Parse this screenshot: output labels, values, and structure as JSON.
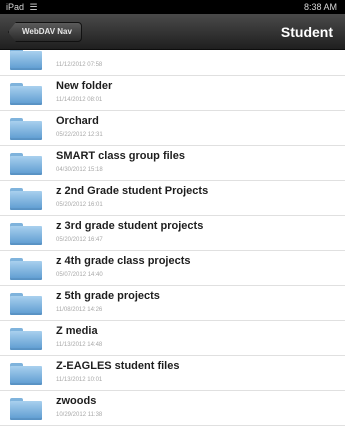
{
  "status_bar": {
    "carrier": "iPad",
    "time": "8:38 AM"
  },
  "nav": {
    "back_label": "WebDAV Nav",
    "title": "Student"
  },
  "folders": [
    {
      "name": "",
      "date": "11/12/2012 07:58"
    },
    {
      "name": "New folder",
      "date": "11/14/2012 08:01"
    },
    {
      "name": "Orchard",
      "date": "05/22/2012 12:31"
    },
    {
      "name": "SMART class group files",
      "date": "04/30/2012 15:18"
    },
    {
      "name": "z 2nd Grade  student Projects",
      "date": "05/20/2012 16:01"
    },
    {
      "name": "z 3rd grade student projects",
      "date": "05/20/2012 16:47"
    },
    {
      "name": "z 4th grade class projects",
      "date": "05/07/2012 14:40"
    },
    {
      "name": "z 5th grade projects",
      "date": "11/08/2012 14:26"
    },
    {
      "name": "Z media",
      "date": "11/13/2012 14:48"
    },
    {
      "name": "Z-EAGLES student files",
      "date": "11/13/2012 10:01"
    },
    {
      "name": "zwoods",
      "date": "10/29/2012 11:38"
    }
  ]
}
